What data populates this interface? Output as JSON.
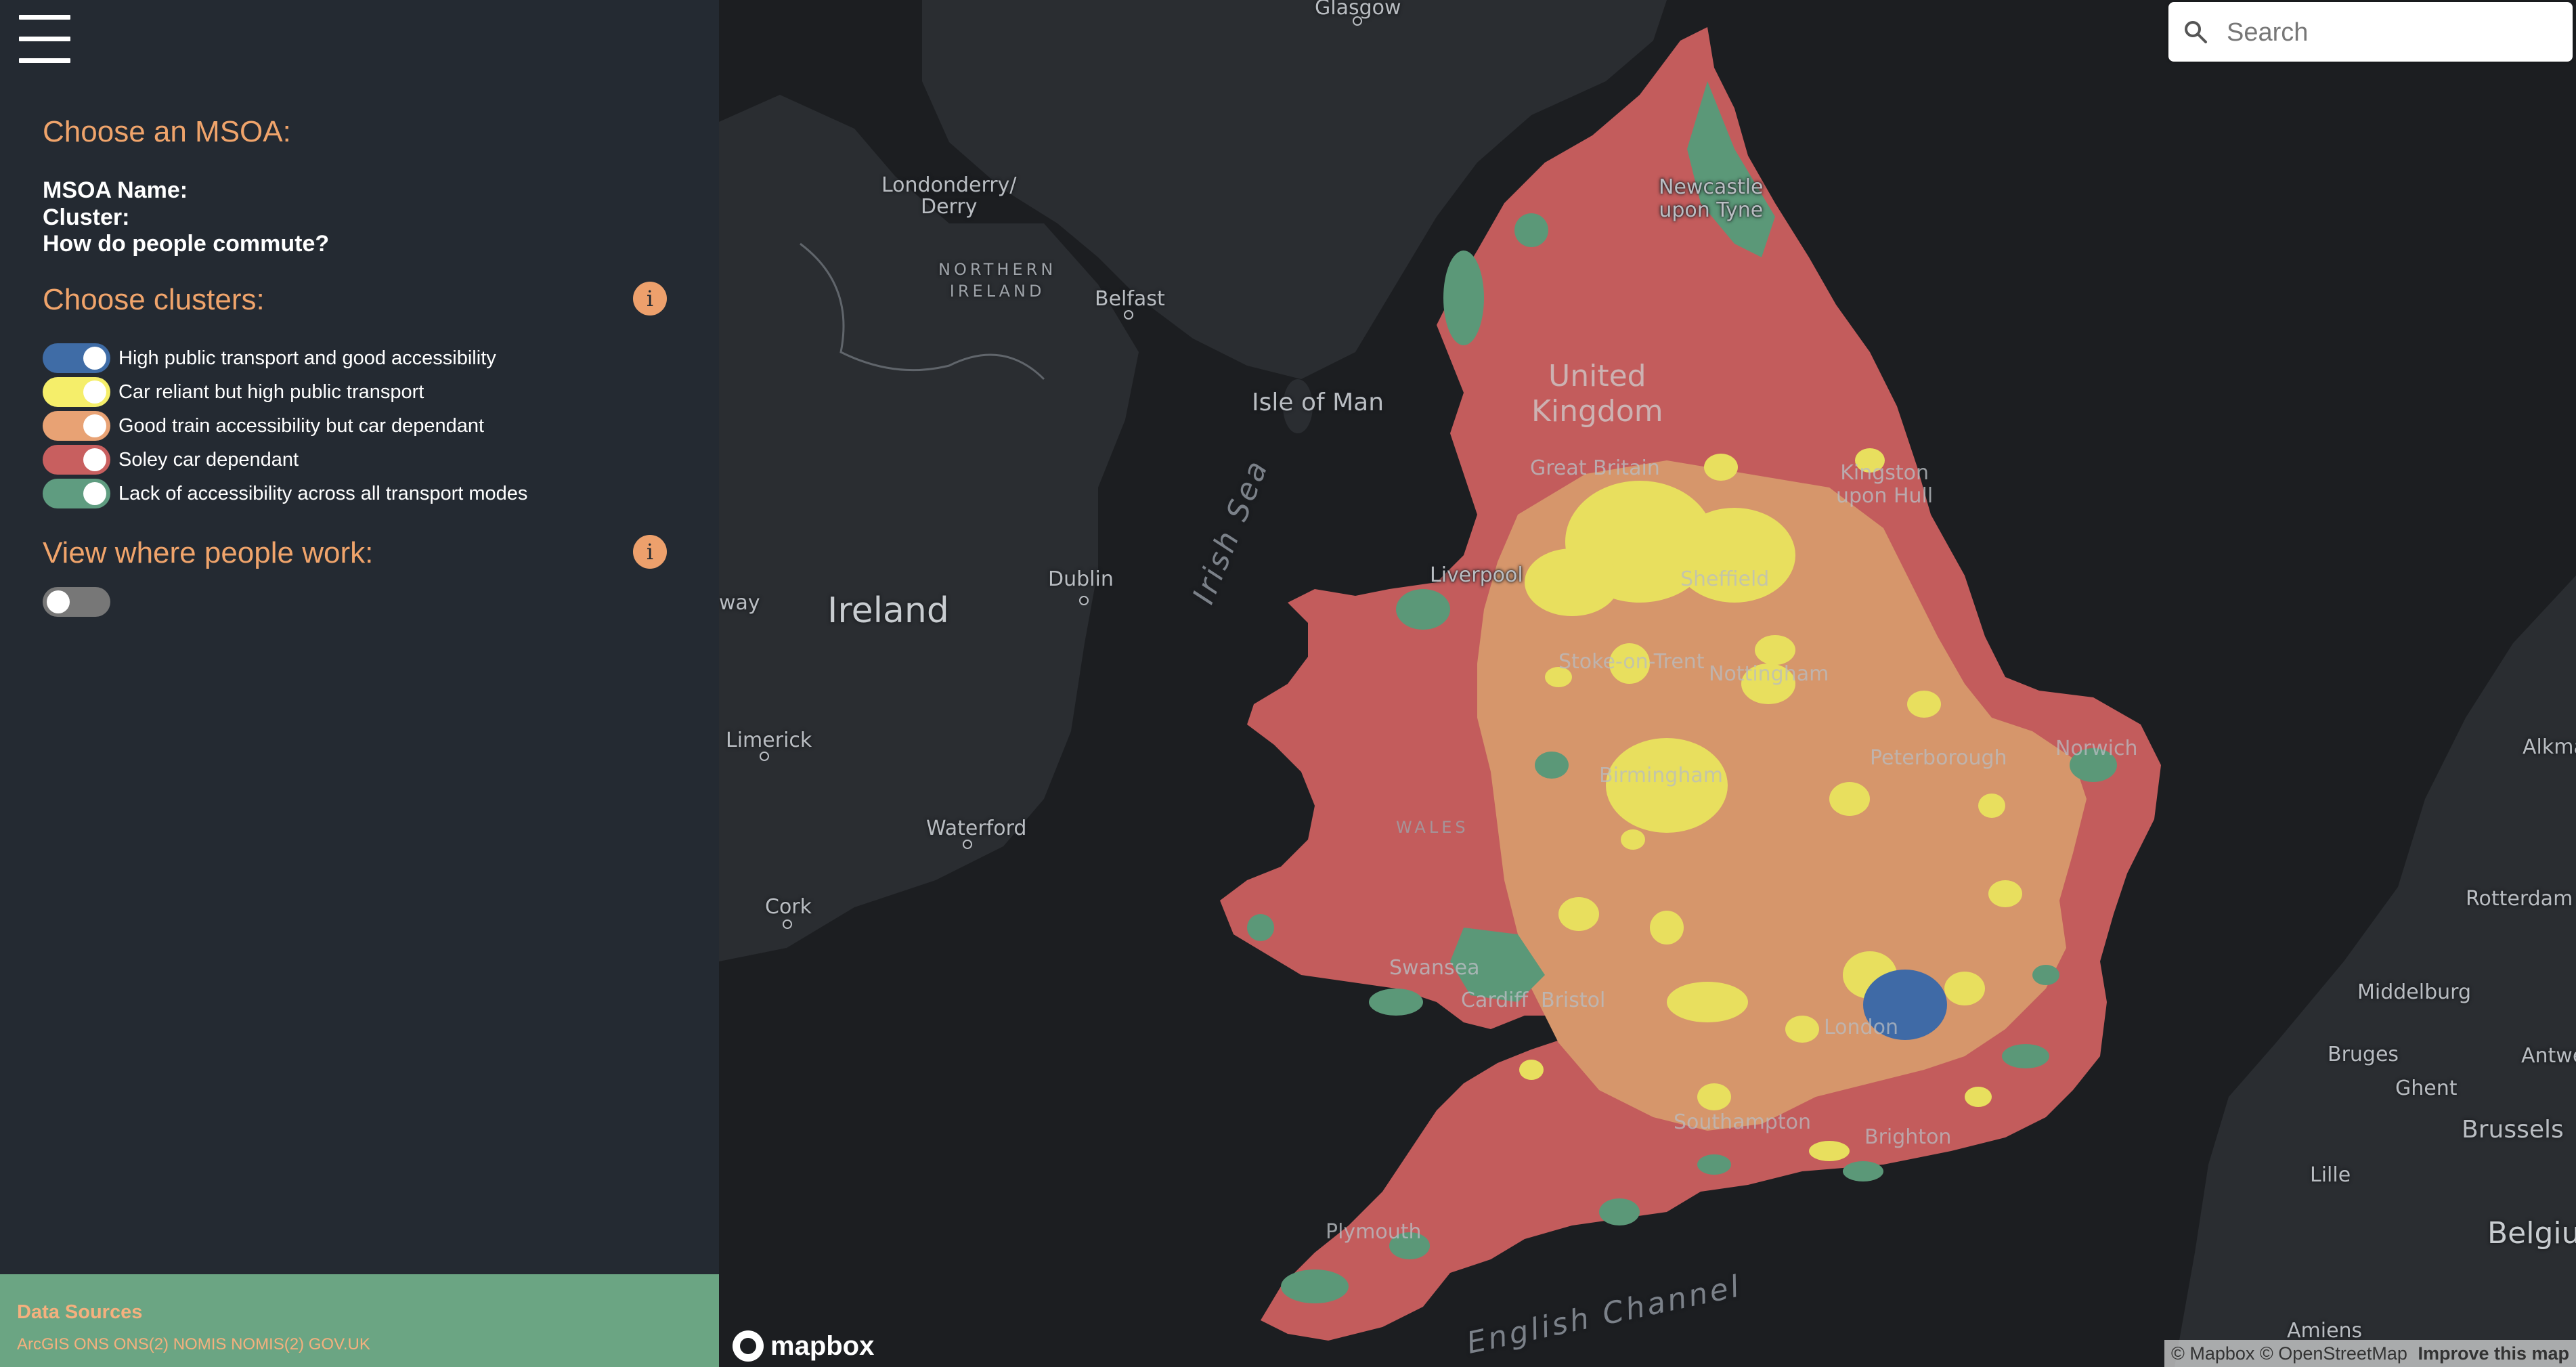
{
  "sidebar": {
    "msoa_heading": "Choose an MSOA:",
    "msoa_name_label": "MSOA Name:",
    "msoa_name_value": "",
    "cluster_label": "Cluster:",
    "cluster_value": "",
    "commute_label": "How do people commute?",
    "clusters_heading": "Choose clusters:",
    "info_glyph": "i",
    "clusters": [
      {
        "label": "High public transport and good accessibility",
        "color": "#3f6ca6",
        "on": true
      },
      {
        "label": "Car reliant but high public transport",
        "color": "#f5ee6a",
        "on": true
      },
      {
        "label": "Good train accessibility but car dependant",
        "color": "#e8a274",
        "on": true
      },
      {
        "label": "Soley car dependant",
        "color": "#c85f5f",
        "on": true
      },
      {
        "label": "Lack of accessibility across all transport modes",
        "color": "#5f9c80",
        "on": true
      }
    ],
    "work_heading": "View where people work:",
    "work_toggle": {
      "on": false,
      "color": "#777777"
    },
    "data_sources": {
      "title": "Data Sources",
      "links": [
        "ArcGIS",
        "ONS",
        "ONS(2)",
        "NOMIS",
        "NOMIS(2)",
        "GOV.UK"
      ]
    }
  },
  "search": {
    "placeholder": "Search",
    "icon": "search-icon"
  },
  "map": {
    "labels": {
      "glasgow": "Glasgow",
      "londonderry": "Londonderry/\nDerry",
      "northern_ireland": "NORTHERN\nIRELAND",
      "belfast": "Belfast",
      "isle_of_man": "Isle of Man",
      "ireland": "Ireland",
      "dublin": "Dublin",
      "irish_sea": "Irish Sea",
      "limerick": "Limerick",
      "waterford": "Waterford",
      "cork": "Cork",
      "way": "way",
      "newcastle": "Newcastle\nupon Tyne",
      "united_kingdom": "United\nKingdom",
      "great_britain": "Great Britain",
      "kingston": "Kingston\nupon Hull",
      "liverpool": "Liverpool",
      "wales": "WALES",
      "norwich": "Norwich",
      "peterborough": "Peterborough",
      "birmingham": "Birmingham",
      "nottingham": "Nottingham",
      "stoke": "Stoke-on-Trent",
      "sheffield": "Sheffield",
      "swansea": "Swansea",
      "cardiff": "Cardiff",
      "bristol": "Bristol",
      "london": "London",
      "southampton": "Southampton",
      "brighton": "Brighton",
      "plymouth": "Plymouth",
      "english_channel": "English Channel",
      "rotterdam": "Rotterdam",
      "middelburg": "Middelburg",
      "bruges": "Bruges",
      "ghent": "Ghent",
      "antwerp": "Antwe",
      "brussels": "Brussels",
      "lille": "Lille",
      "belgium": "Belgiu",
      "amiens": "Amiens",
      "alkmaar": "Alkma"
    },
    "logo_text": "mapbox",
    "attribution": {
      "mapbox": "© Mapbox",
      "osm": "© OpenStreetMap",
      "improve": "Improve this map"
    }
  }
}
